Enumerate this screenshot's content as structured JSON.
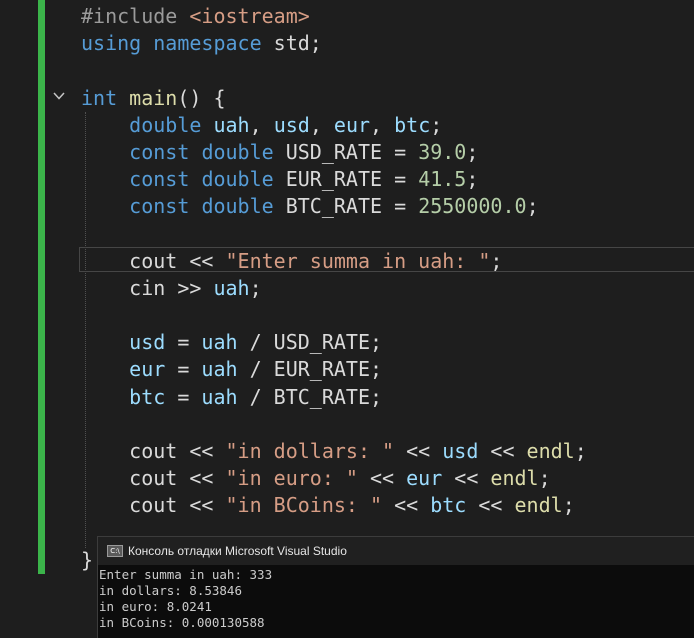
{
  "editor": {
    "lines": [
      [
        {
          "t": "#include ",
          "c": "c-pre"
        },
        {
          "t": "<iostream>",
          "c": "c-str"
        }
      ],
      [
        {
          "t": "using",
          "c": "c-kw"
        },
        {
          "t": " ",
          "c": "c-plain"
        },
        {
          "t": "namespace",
          "c": "c-kw"
        },
        {
          "t": " std;",
          "c": "c-plain"
        }
      ],
      [],
      [
        {
          "t": "int",
          "c": "c-kw"
        },
        {
          "t": " ",
          "c": "c-plain"
        },
        {
          "t": "main",
          "c": "c-fn"
        },
        {
          "t": "() {",
          "c": "c-plain"
        }
      ],
      [
        {
          "t": "    ",
          "c": "c-plain"
        },
        {
          "t": "double",
          "c": "c-kw"
        },
        {
          "t": " ",
          "c": "c-plain"
        },
        {
          "t": "uah",
          "c": "c-var"
        },
        {
          "t": ", ",
          "c": "c-plain"
        },
        {
          "t": "usd",
          "c": "c-var"
        },
        {
          "t": ", ",
          "c": "c-plain"
        },
        {
          "t": "eur",
          "c": "c-var"
        },
        {
          "t": ", ",
          "c": "c-plain"
        },
        {
          "t": "btc",
          "c": "c-var"
        },
        {
          "t": ";",
          "c": "c-plain"
        }
      ],
      [
        {
          "t": "    ",
          "c": "c-plain"
        },
        {
          "t": "const",
          "c": "c-kw"
        },
        {
          "t": " ",
          "c": "c-plain"
        },
        {
          "t": "double",
          "c": "c-kw"
        },
        {
          "t": " USD_RATE = ",
          "c": "c-const"
        },
        {
          "t": "39.0",
          "c": "c-num"
        },
        {
          "t": ";",
          "c": "c-plain"
        }
      ],
      [
        {
          "t": "    ",
          "c": "c-plain"
        },
        {
          "t": "const",
          "c": "c-kw"
        },
        {
          "t": " ",
          "c": "c-plain"
        },
        {
          "t": "double",
          "c": "c-kw"
        },
        {
          "t": " EUR_RATE = ",
          "c": "c-const"
        },
        {
          "t": "41.5",
          "c": "c-num"
        },
        {
          "t": ";",
          "c": "c-plain"
        }
      ],
      [
        {
          "t": "    ",
          "c": "c-plain"
        },
        {
          "t": "const",
          "c": "c-kw"
        },
        {
          "t": " ",
          "c": "c-plain"
        },
        {
          "t": "double",
          "c": "c-kw"
        },
        {
          "t": " BTC_RATE = ",
          "c": "c-const"
        },
        {
          "t": "2550000.0",
          "c": "c-num"
        },
        {
          "t": ";",
          "c": "c-plain"
        }
      ],
      [],
      [
        {
          "t": "    cout << ",
          "c": "c-plain"
        },
        {
          "t": "\"Enter summa in uah: \"",
          "c": "c-str"
        },
        {
          "t": ";",
          "c": "c-plain"
        }
      ],
      [
        {
          "t": "    cin >> ",
          "c": "c-plain"
        },
        {
          "t": "uah",
          "c": "c-var"
        },
        {
          "t": ";",
          "c": "c-plain"
        }
      ],
      [],
      [
        {
          "t": "    ",
          "c": "c-plain"
        },
        {
          "t": "usd",
          "c": "c-var"
        },
        {
          "t": " = ",
          "c": "c-plain"
        },
        {
          "t": "uah",
          "c": "c-var"
        },
        {
          "t": " / USD_RATE;",
          "c": "c-plain"
        }
      ],
      [
        {
          "t": "    ",
          "c": "c-plain"
        },
        {
          "t": "eur",
          "c": "c-var"
        },
        {
          "t": " = ",
          "c": "c-plain"
        },
        {
          "t": "uah",
          "c": "c-var"
        },
        {
          "t": " / EUR_RATE;",
          "c": "c-plain"
        }
      ],
      [
        {
          "t": "    ",
          "c": "c-plain"
        },
        {
          "t": "btc",
          "c": "c-var"
        },
        {
          "t": " = ",
          "c": "c-plain"
        },
        {
          "t": "uah",
          "c": "c-var"
        },
        {
          "t": " / BTC_RATE;",
          "c": "c-plain"
        }
      ],
      [],
      [
        {
          "t": "    cout << ",
          "c": "c-plain"
        },
        {
          "t": "\"in dollars: \"",
          "c": "c-str"
        },
        {
          "t": " << ",
          "c": "c-plain"
        },
        {
          "t": "usd",
          "c": "c-var"
        },
        {
          "t": " << ",
          "c": "c-plain"
        },
        {
          "t": "endl",
          "c": "c-fn"
        },
        {
          "t": ";",
          "c": "c-plain"
        }
      ],
      [
        {
          "t": "    cout << ",
          "c": "c-plain"
        },
        {
          "t": "\"in euro: \"",
          "c": "c-str"
        },
        {
          "t": " << ",
          "c": "c-plain"
        },
        {
          "t": "eur",
          "c": "c-var"
        },
        {
          "t": " << ",
          "c": "c-plain"
        },
        {
          "t": "endl",
          "c": "c-fn"
        },
        {
          "t": ";",
          "c": "c-plain"
        }
      ],
      [
        {
          "t": "    cout << ",
          "c": "c-plain"
        },
        {
          "t": "\"in BCoins: \"",
          "c": "c-str"
        },
        {
          "t": " << ",
          "c": "c-plain"
        },
        {
          "t": "btc",
          "c": "c-var"
        },
        {
          "t": " << ",
          "c": "c-plain"
        },
        {
          "t": "endl",
          "c": "c-fn"
        },
        {
          "t": ";",
          "c": "c-plain"
        }
      ],
      [],
      [
        {
          "t": "}",
          "c": "c-plain"
        }
      ]
    ]
  },
  "console": {
    "icon_label": "C:\\",
    "title": "Консоль отладки Microsoft Visual Studio",
    "output": [
      "Enter summa in uah: 333",
      "in dollars: 8.53846",
      "in euro: 8.0241",
      "in BCoins: 0.000130588"
    ]
  },
  "colors": {
    "background": "#1e1e1e",
    "change_bar": "#3bb44a",
    "console_bg": "#0c0c0c",
    "console_titlebar": "#202020"
  }
}
